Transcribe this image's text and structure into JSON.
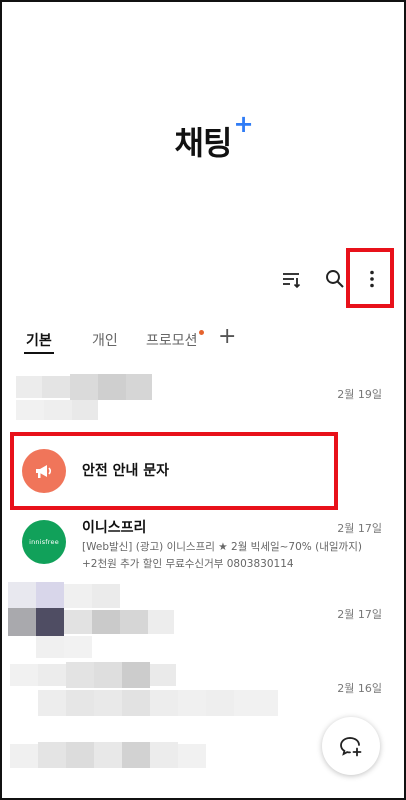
{
  "header": {
    "title": "채팅",
    "title_badge": "+"
  },
  "toolbar": {
    "sort_icon": "sort-filter-icon",
    "search_icon": "search-icon",
    "more_icon": "more-vertical-icon"
  },
  "tabs": [
    {
      "label": "기본",
      "active": true
    },
    {
      "label": "개인",
      "active": false
    },
    {
      "label": "프로모션",
      "active": false,
      "has_dot": true
    }
  ],
  "add_tab_label": "+",
  "chats": [
    {
      "id": "blurred-1",
      "date": "2월 19일"
    },
    {
      "id": "safety",
      "name": "안전 안내 문자",
      "icon": "megaphone-icon"
    },
    {
      "id": "innisfree",
      "name": "이니스프리",
      "avatar_text": "innisfree",
      "date": "2월 17일",
      "preview_line1": "[Web발신] (광고) 이니스프리 ★ 2월 빅세일~70% (내일까지)",
      "preview_line2": "+2천원 추가 할인 무료수신거부 0803830114"
    },
    {
      "id": "blurred-2",
      "date": "2월 17일"
    },
    {
      "id": "blurred-3",
      "date": "2월 16일"
    }
  ],
  "fab_icon": "new-chat-icon",
  "colors": {
    "accent_blue": "#2f7cf6",
    "highlight_red": "#e8111a",
    "safety_orange": "#f0755a",
    "innisfree_green": "#11a15a",
    "promo_dot": "#e5632d"
  }
}
